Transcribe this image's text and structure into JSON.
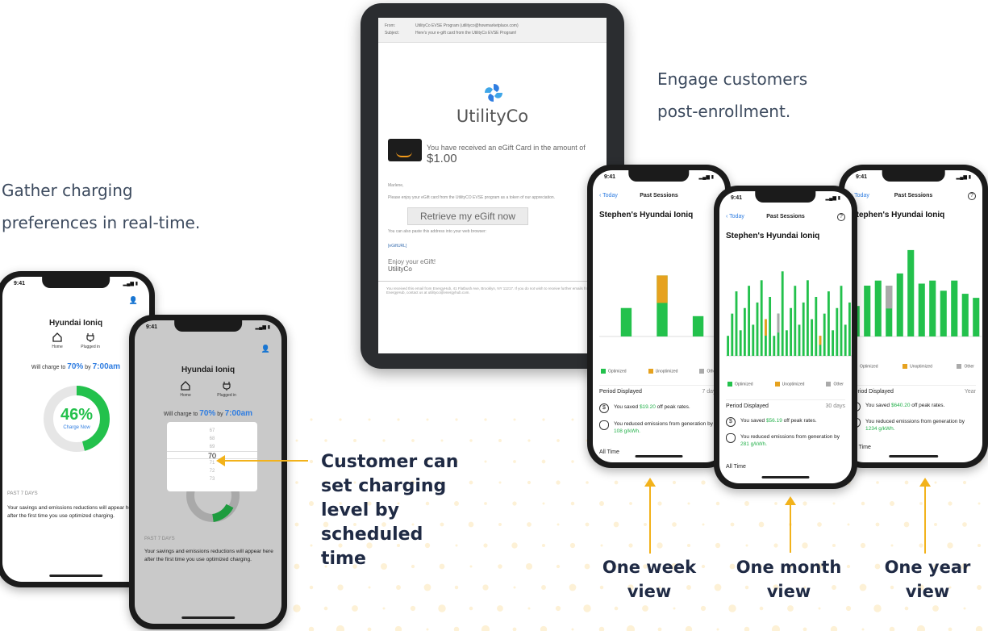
{
  "captions": {
    "gather": [
      "Gather charging",
      "preferences in real-time."
    ],
    "engage": [
      "Engage customers",
      "post-enrollment."
    ]
  },
  "callout": [
    "Customer can",
    "set charging",
    "level by",
    "scheduled",
    "time"
  ],
  "view_labels": {
    "week": [
      "One week",
      "view"
    ],
    "month": [
      "One month",
      "view"
    ],
    "year": [
      "One year",
      "view"
    ]
  },
  "email": {
    "from_label": "From:",
    "from_value": "UtilityCo EVSE Program (utilityco@howmarketplace.com)",
    "subject_label": "Subject:",
    "subject_value": "Here's your e-gift card from the UtilityCo EVSE Program!",
    "brand": "UtilityCo",
    "received_text": "You have received an eGift Card in the amount of",
    "amount": "$1.00",
    "greeting": "Marlene,",
    "body": "Please enjoy your eGift card from the UtilityCO EVSE program as a token of our appreciation.",
    "button": "Retrieve my eGift now",
    "paste_note": "You can also paste this address into your web browser:",
    "link": "[eGiftURL]",
    "enjoy": "Enjoy your eGift!",
    "signoff": "UtilityCo",
    "footer": "You received this email from EnergyHub, 41 Flatbush Ave, Brooklyn, NY 11217. If you do not wish to receive further emails from EnergyHub, contact us at utilityco@energyhub.com."
  },
  "phone_charge": {
    "time": "9:41",
    "car": "Hyundai Ioniq",
    "home": "Home",
    "plugged": "Plugged in",
    "will_charge_prefix": "Will charge to",
    "pct": "70%",
    "by": "by",
    "time_target": "7:00am",
    "gauge_pct": "46%",
    "gauge_label": "Charge Now",
    "gauge_fraction": 0.46,
    "past": "PAST 7 DAYS",
    "note": "Your savings and emissions reductions will appear here after the first time you use optimized charging.",
    "picker": [
      "67",
      "68",
      "69",
      "70",
      "71",
      "72",
      "73"
    ],
    "picker_selected": "70"
  },
  "session_phones": {
    "time": "9:41",
    "back": "Today",
    "title": "Past Sessions",
    "help": "?",
    "car": "Stephen's Hyundai Ioniq",
    "legend": [
      "Optimized",
      "Unoptimized",
      "Other"
    ],
    "period_label": "Period Displayed",
    "all_time": "All Time",
    "week": {
      "period": "7 days",
      "saved": "$19.20",
      "emissions": "108 g/kWh."
    },
    "month": {
      "period": "30 days",
      "saved": "$56.19",
      "emissions": "281 g/kWh."
    },
    "year": {
      "period": "Year",
      "saved": "$640.20",
      "emissions": "1234 g/kWh."
    },
    "saved_prefix": "You saved",
    "saved_suffix": "off peak rates.",
    "emis_prefix": "You reduced emissions from generation by"
  },
  "colors": {
    "accent": "#f2b21b",
    "optimized": "#23c14c",
    "unoptimized": "#e6a21f",
    "other": "#aaaaaa",
    "blue": "#2f7de1"
  }
}
